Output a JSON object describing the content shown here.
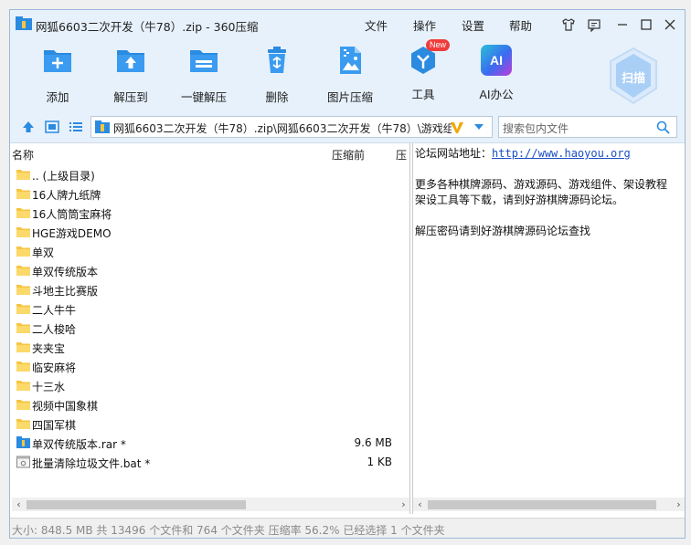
{
  "window": {
    "title": "网狐6603二次开发（牛78）.zip - 360压缩",
    "menu": [
      "文件",
      "操作",
      "设置",
      "帮助"
    ]
  },
  "toolbar": {
    "buttons": [
      {
        "label": "添加",
        "icon": "add-icon"
      },
      {
        "label": "解压到",
        "icon": "extract-to-icon"
      },
      {
        "label": "一键解压",
        "icon": "one-click-extract-icon"
      },
      {
        "label": "删除",
        "icon": "delete-icon"
      },
      {
        "label": "图片压缩",
        "icon": "image-compress-icon"
      },
      {
        "label": "工具",
        "icon": "tools-icon",
        "badge": "New"
      },
      {
        "label": "AI办公",
        "icon": "ai-office-icon",
        "icon_text": "AI"
      }
    ],
    "scan_label": "扫描"
  },
  "address": {
    "path": "网狐6603二次开发（牛78）.zip\\网狐6603二次开发（牛78）\\游戏组",
    "search_placeholder": "搜索包内文件"
  },
  "file_list": {
    "columns": {
      "name": "名称",
      "compressed": "压缩前",
      "extra": "压"
    },
    "rows": [
      {
        "name": ".. (上级目录)",
        "type": "folder",
        "size": ""
      },
      {
        "name": "16人牌九纸牌",
        "type": "folder",
        "size": ""
      },
      {
        "name": "16人筒筒宝麻将",
        "type": "folder",
        "size": ""
      },
      {
        "name": "HGE游戏DEMO",
        "type": "folder",
        "size": ""
      },
      {
        "name": "单双",
        "type": "folder",
        "size": ""
      },
      {
        "name": "单双传统版本",
        "type": "folder",
        "size": ""
      },
      {
        "name": "斗地主比赛版",
        "type": "folder",
        "size": ""
      },
      {
        "name": "二人牛牛",
        "type": "folder",
        "size": ""
      },
      {
        "name": "二人梭哈",
        "type": "folder",
        "size": ""
      },
      {
        "name": "夹夹宝",
        "type": "folder",
        "size": ""
      },
      {
        "name": "临安麻将",
        "type": "folder",
        "size": ""
      },
      {
        "name": "十三水",
        "type": "folder",
        "size": ""
      },
      {
        "name": "视频中国象棋",
        "type": "folder",
        "size": ""
      },
      {
        "name": "四国军棋",
        "type": "folder",
        "size": ""
      },
      {
        "name": "单双传统版本.rar *",
        "type": "rar",
        "size": "9.6 MB"
      },
      {
        "name": "批量清除垃圾文件.bat *",
        "type": "bat",
        "size": "1 KB"
      }
    ]
  },
  "preview": {
    "line1_prefix": "论坛网站地址：",
    "line1_link": "http://www.haoyou.org",
    "line2": "更多各种棋牌源码、游戏源码、游戏组件、架设教程",
    "line3": "架设工具等下载，请到好游棋牌源码论坛。",
    "line4": "解压密码请到好游棋牌源码论坛查找"
  },
  "status": {
    "text": "大小: 848.5 MB 共 13496 个文件和 764 个文件夹 压缩率 56.2% 已经选择 1 个文件夹"
  },
  "colors": {
    "accent": "#2b8be0",
    "titlebar": "#e7f1fb",
    "folder": "#f5c542"
  }
}
